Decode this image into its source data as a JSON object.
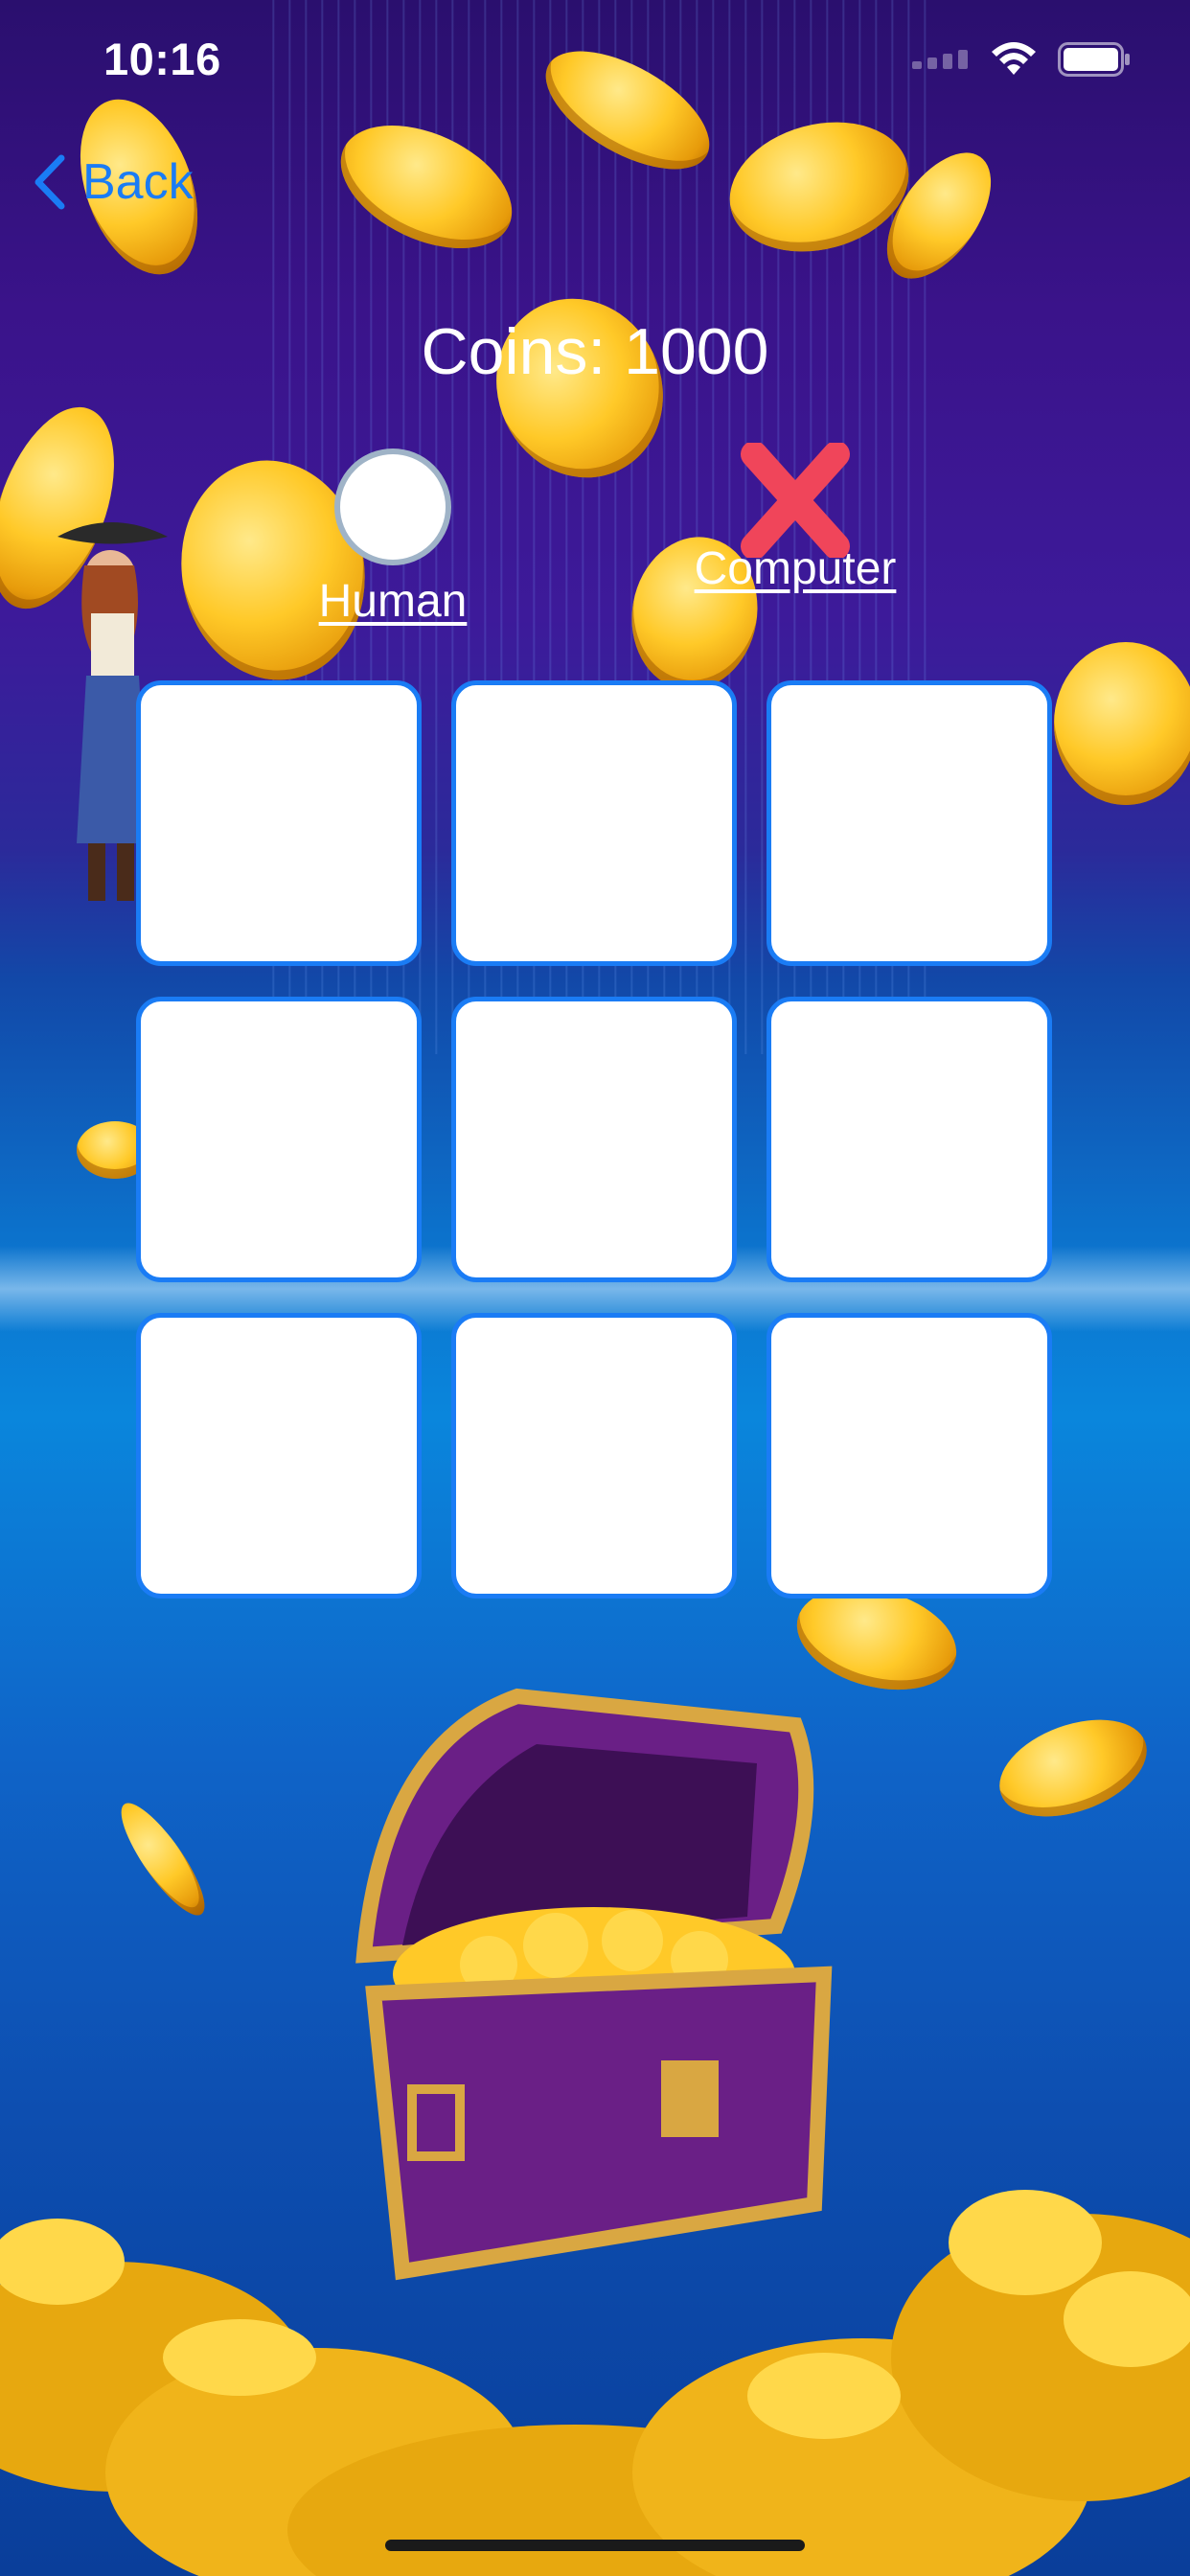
{
  "status_bar": {
    "time": "10:16",
    "icons": [
      "cellular-signal-icon",
      "wifi-icon",
      "battery-icon"
    ]
  },
  "nav": {
    "back_label": "Back",
    "back_icon": "chevron-left-icon"
  },
  "coins": {
    "label": "Coins: 1000"
  },
  "players": {
    "human": {
      "name": "Human",
      "marker": "circle"
    },
    "computer": {
      "name": "Computer",
      "marker": "cross"
    }
  },
  "board": {
    "cells": [
      "",
      "",
      "",
      "",
      "",
      "",
      "",
      "",
      ""
    ]
  },
  "colors": {
    "accent": "#1a7cf5",
    "cross": "#f0455a",
    "coin": "#ffc928",
    "background_top": "#2a0f6e",
    "background_bottom": "#0a3e9a"
  }
}
